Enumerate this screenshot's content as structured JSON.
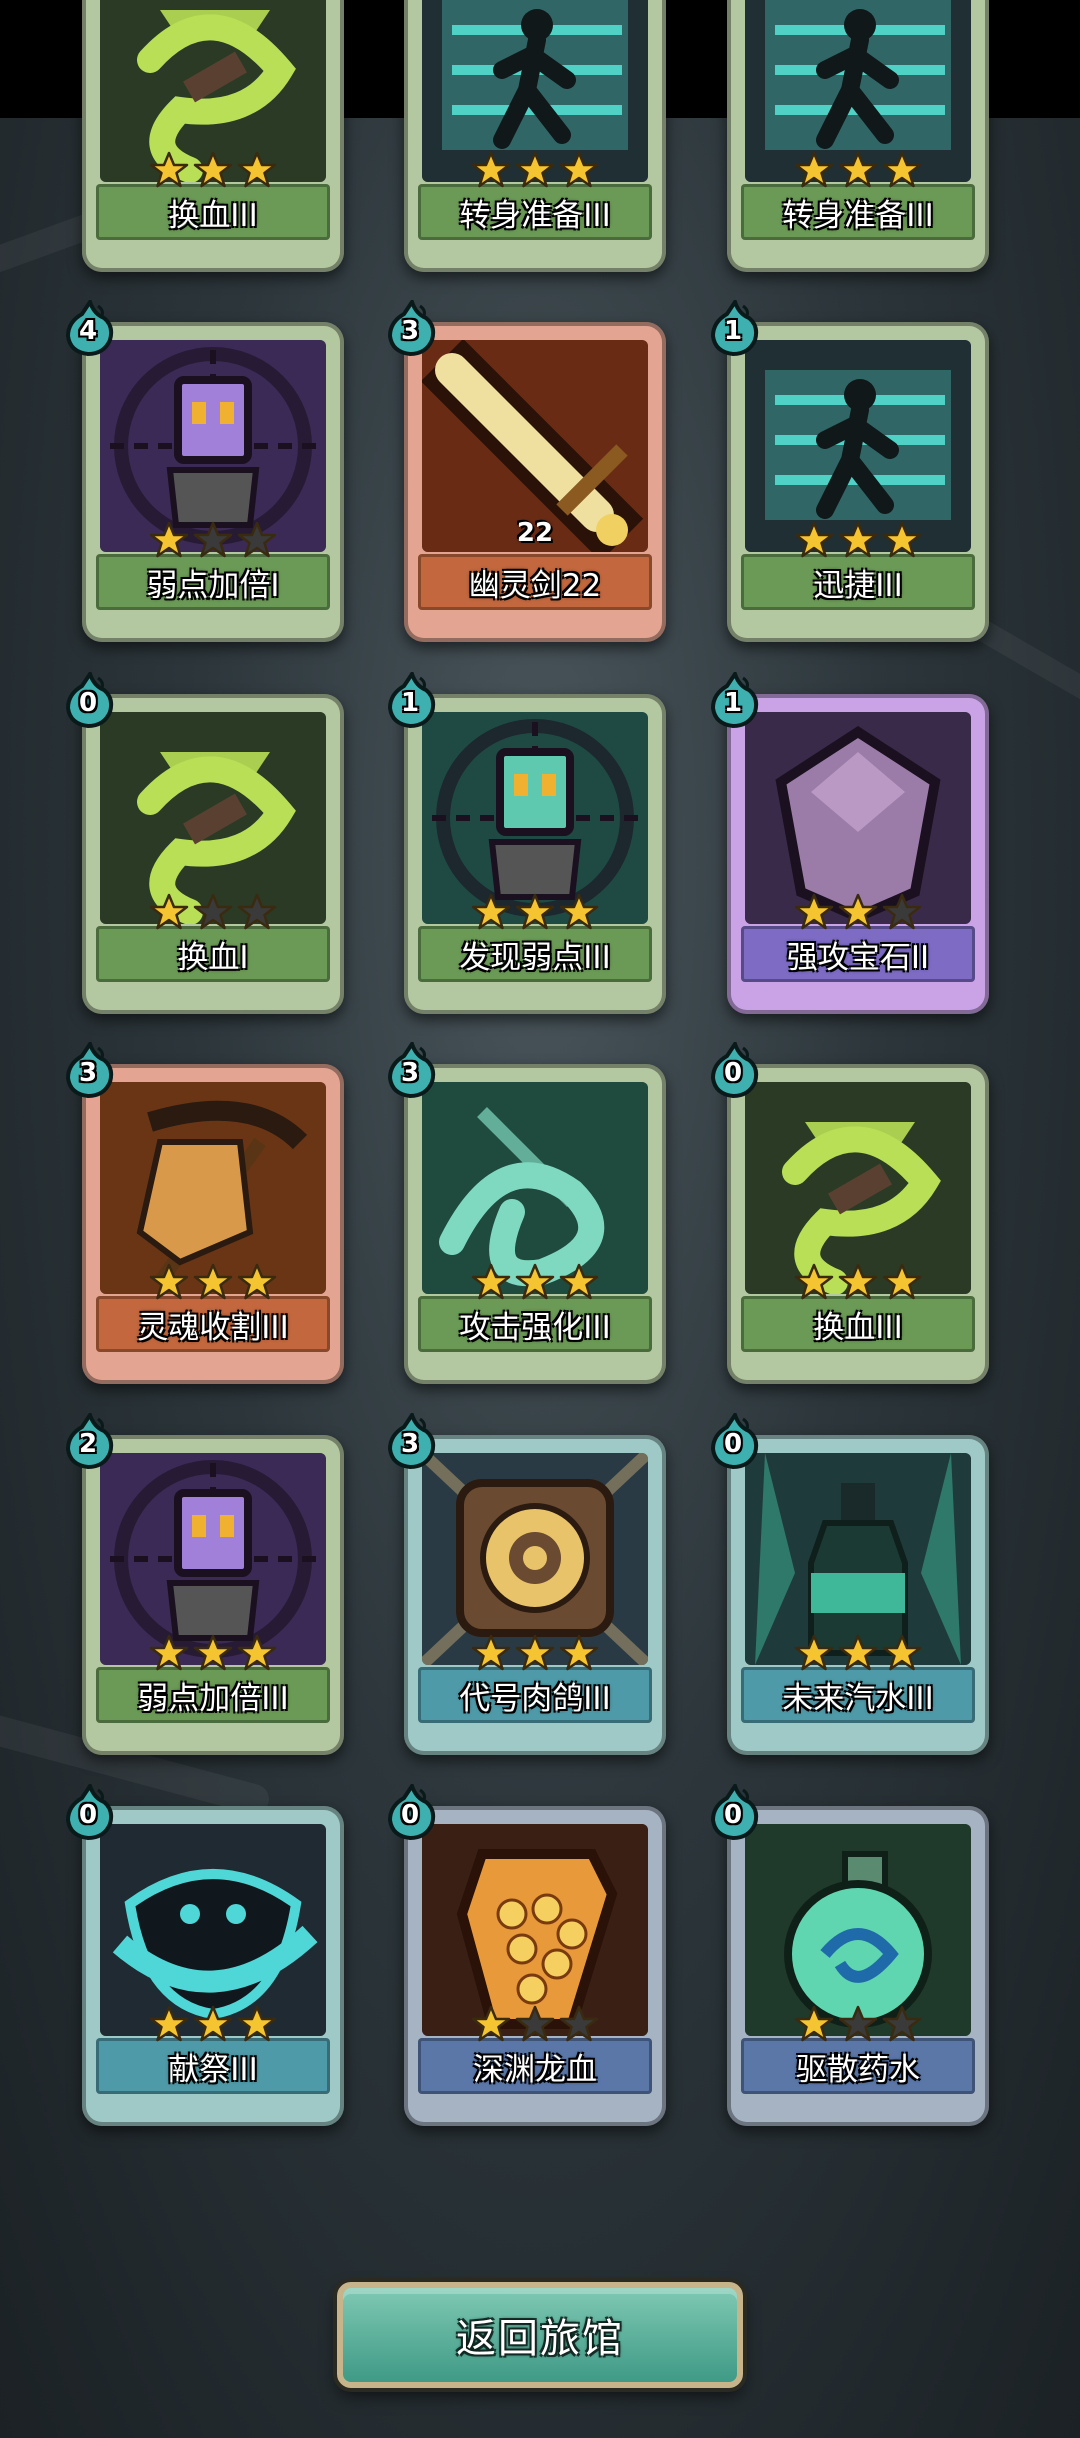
{
  "cards": [
    {
      "name": "换血III",
      "cost": null,
      "stars": 3,
      "rarity": "green",
      "art": "hourglass-icon",
      "art_bg": "#2b3a25",
      "art_fg": "#b8df55"
    },
    {
      "name": "转身准备III",
      "cost": null,
      "stars": 3,
      "rarity": "green",
      "art": "runner-icon",
      "art_bg": "#1f2f33",
      "art_fg": "#4fd1c5"
    },
    {
      "name": "转身准备III",
      "cost": null,
      "stars": 3,
      "rarity": "green",
      "art": "runner-icon",
      "art_bg": "#1f2f33",
      "art_fg": "#4fd1c5"
    },
    {
      "name": "弱点加倍I",
      "cost": "4",
      "stars": 1,
      "rarity": "green",
      "art": "target-robot-icon",
      "art_bg": "#3a2a55",
      "art_fg": "#a080d8"
    },
    {
      "name": "幽灵剑22",
      "cost": "3",
      "stars": 0,
      "level": "22",
      "rarity": "orange",
      "art": "sword-icon",
      "art_bg": "#6a2b15",
      "art_fg": "#f0e0a0"
    },
    {
      "name": "迅捷III",
      "cost": "1",
      "stars": 3,
      "rarity": "green",
      "art": "runner-icon",
      "art_bg": "#1f2f33",
      "art_fg": "#4fd1c5"
    },
    {
      "name": "换血I",
      "cost": "0",
      "stars": 1,
      "rarity": "green",
      "art": "hourglass-icon",
      "art_bg": "#2b3a25",
      "art_fg": "#b8df55"
    },
    {
      "name": "发现弱点III",
      "cost": "1",
      "stars": 3,
      "rarity": "green",
      "art": "target-robot-icon",
      "art_bg": "#1f4a44",
      "art_fg": "#5fc9b0"
    },
    {
      "name": "强攻宝石II",
      "cost": "1",
      "stars": 2,
      "rarity": "purple",
      "art": "gem-icon",
      "art_bg": "#3a2a4a",
      "art_fg": "#9b7ba8"
    },
    {
      "name": "灵魂收割III",
      "cost": "3",
      "stars": 3,
      "rarity": "orange",
      "art": "scythe-icon",
      "art_bg": "#6a3515",
      "art_fg": "#d89a4a"
    },
    {
      "name": "攻击强化III",
      "cost": "3",
      "stars": 3,
      "rarity": "green",
      "art": "swirl-icon",
      "art_bg": "#1f4a3e",
      "art_fg": "#7fd9c0"
    },
    {
      "name": "换血III",
      "cost": "0",
      "stars": 3,
      "rarity": "green",
      "art": "hourglass-icon",
      "art_bg": "#2b3a25",
      "art_fg": "#b8df55"
    },
    {
      "name": "弱点加倍III",
      "cost": "2",
      "stars": 3,
      "rarity": "green",
      "art": "target-robot-icon",
      "art_bg": "#3a2a55",
      "art_fg": "#a080d8"
    },
    {
      "name": "代号肉鸽III",
      "cost": "3",
      "stars": 3,
      "rarity": "teal",
      "art": "coin-icon",
      "art_bg": "#2a3a44",
      "art_fg": "#e8c36a"
    },
    {
      "name": "未来汽水III",
      "cost": "0",
      "stars": 3,
      "rarity": "teal",
      "art": "bottle-icon",
      "art_bg": "#1f3a3a",
      "art_fg": "#3fb89a"
    },
    {
      "name": "献祭III",
      "cost": "0",
      "stars": 3,
      "rarity": "teal",
      "art": "skull-swirl-icon",
      "art_bg": "#1f2a33",
      "art_fg": "#4fd6d6"
    },
    {
      "name": "深渊龙血",
      "cost": "0",
      "stars": 1,
      "rarity": "blue",
      "art": "dragon-blood-icon",
      "art_bg": "#3a1f15",
      "art_fg": "#e89a3a"
    },
    {
      "name": "驱散药水",
      "cost": "0",
      "stars": 1,
      "rarity": "blue",
      "art": "potion-icon",
      "art_bg": "#1f3a2a",
      "art_fg": "#5fd6b0"
    }
  ],
  "footer": {
    "return_label": "返回旅馆"
  },
  "colors": {
    "star": "#f5c431",
    "star_empty": "#3a3a3a",
    "cost_drop": "#3fb0b0"
  }
}
